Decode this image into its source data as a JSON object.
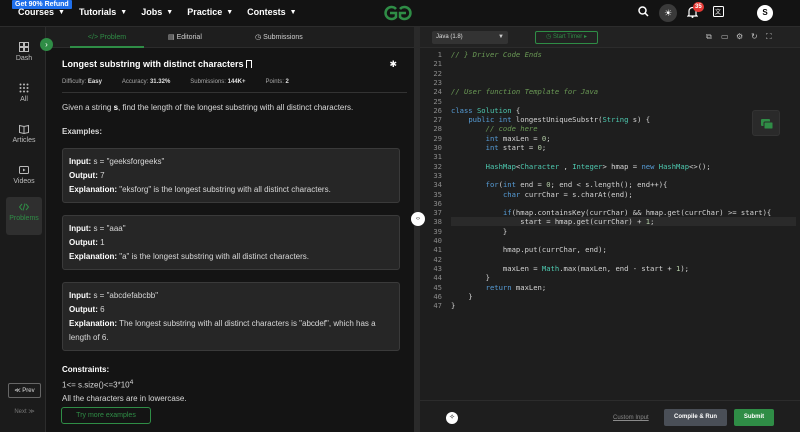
{
  "topbar": {
    "promo_badge": "Get 90% Refund",
    "nav": [
      "Courses",
      "Tutorials",
      "Jobs",
      "Practice",
      "Contests"
    ],
    "notification_count": "35",
    "avatar_letter": "S"
  },
  "sidebar": {
    "items": [
      {
        "label": "Dash",
        "icon": "dashboard-icon"
      },
      {
        "label": "All",
        "icon": "grid-icon"
      },
      {
        "label": "Articles",
        "icon": "book-icon"
      },
      {
        "label": "Videos",
        "icon": "video-icon"
      },
      {
        "label": "Problems",
        "icon": "code-icon"
      }
    ],
    "prev": "≪ Prev",
    "next": "Next ≫"
  },
  "tabs": [
    {
      "label": "Problem",
      "icon": "</>"
    },
    {
      "label": "Editorial",
      "icon": "▤"
    },
    {
      "label": "Submissions",
      "icon": "◷"
    }
  ],
  "problem": {
    "title": "Longest substring with distinct characters",
    "meta": {
      "difficulty_label": "Difficulty:",
      "difficulty": "Easy",
      "accuracy_label": "Accuracy:",
      "accuracy": "31.32%",
      "submissions_label": "Submissions:",
      "submissions": "144K+",
      "points_label": "Points:",
      "points": "2"
    },
    "desc_pre": "Given a string ",
    "desc_var": "s",
    "desc_post": ", find the length of the longest substring with all distinct characters.",
    "examples_heading": "Examples:",
    "examples": [
      {
        "input_label": "Input:",
        "input": "s = \"geeksforgeeks\"",
        "output_label": "Output:",
        "output": "7",
        "expl_label": "Explanation:",
        "expl": "\"eksforg\" is the longest substring with all distinct characters."
      },
      {
        "input_label": "Input:",
        "input": "s = \"aaa\"",
        "output_label": "Output:",
        "output": "1",
        "expl_label": "Explanation:",
        "expl": "\"a\" is the longest substring with all distinct characters."
      },
      {
        "input_label": "Input:",
        "input": "s = \"abcdefabcbb\"",
        "output_label": "Output:",
        "output": "6",
        "expl_label": "Explanation:",
        "expl": "The longest substring with all distinct characters is \"abcdef\", which has a length of 6."
      }
    ],
    "constraints_heading": "Constraints:",
    "constraint_1_base": "1<= s.size()<=3*10",
    "constraint_1_exp": "4",
    "constraint_2": "All the characters are in lowercase.",
    "try_more": "Try more examples"
  },
  "editor": {
    "language": "Java (1.8)",
    "timer": "Start Timer",
    "custom_input": "Custom Input",
    "compile_run": "Compile & Run",
    "submit": "Submit"
  },
  "code_lines": [
    {
      "n": "1",
      "t": "// } Driver Code Ends"
    },
    {
      "n": "21",
      "t": ""
    },
    {
      "n": "22",
      "t": ""
    },
    {
      "n": "23",
      "t": ""
    },
    {
      "n": "24",
      "t": "// User function Template for Java"
    },
    {
      "n": "25",
      "t": ""
    },
    {
      "n": "26",
      "t": "class Solution {"
    },
    {
      "n": "27",
      "t": "    public int longestUniqueSubstr(String s) {"
    },
    {
      "n": "28",
      "t": "        // code here"
    },
    {
      "n": "29",
      "t": "        int maxLen = 0;"
    },
    {
      "n": "30",
      "t": "        int start = 0;"
    },
    {
      "n": "31",
      "t": ""
    },
    {
      "n": "32",
      "t": "        HashMap<Character , Integer> hmap = new HashMap<>();"
    },
    {
      "n": "33",
      "t": ""
    },
    {
      "n": "34",
      "t": "        for(int end = 0; end < s.length(); end++){"
    },
    {
      "n": "35",
      "t": "            char currChar = s.charAt(end);"
    },
    {
      "n": "36",
      "t": ""
    },
    {
      "n": "37",
      "t": "            if(hmap.containsKey(currChar) && hmap.get(currChar) >= start){"
    },
    {
      "n": "38",
      "t": "                start = hmap.get(currChar) + 1;"
    },
    {
      "n": "39",
      "t": "            }"
    },
    {
      "n": "40",
      "t": ""
    },
    {
      "n": "41",
      "t": "            hmap.put(currChar, end);"
    },
    {
      "n": "42",
      "t": ""
    },
    {
      "n": "43",
      "t": "            maxLen = Math.max(maxLen, end - start + 1);"
    },
    {
      "n": "44",
      "t": "        }"
    },
    {
      "n": "45",
      "t": "        return maxLen;"
    },
    {
      "n": "46",
      "t": "    }"
    },
    {
      "n": "47",
      "t": "}"
    }
  ]
}
